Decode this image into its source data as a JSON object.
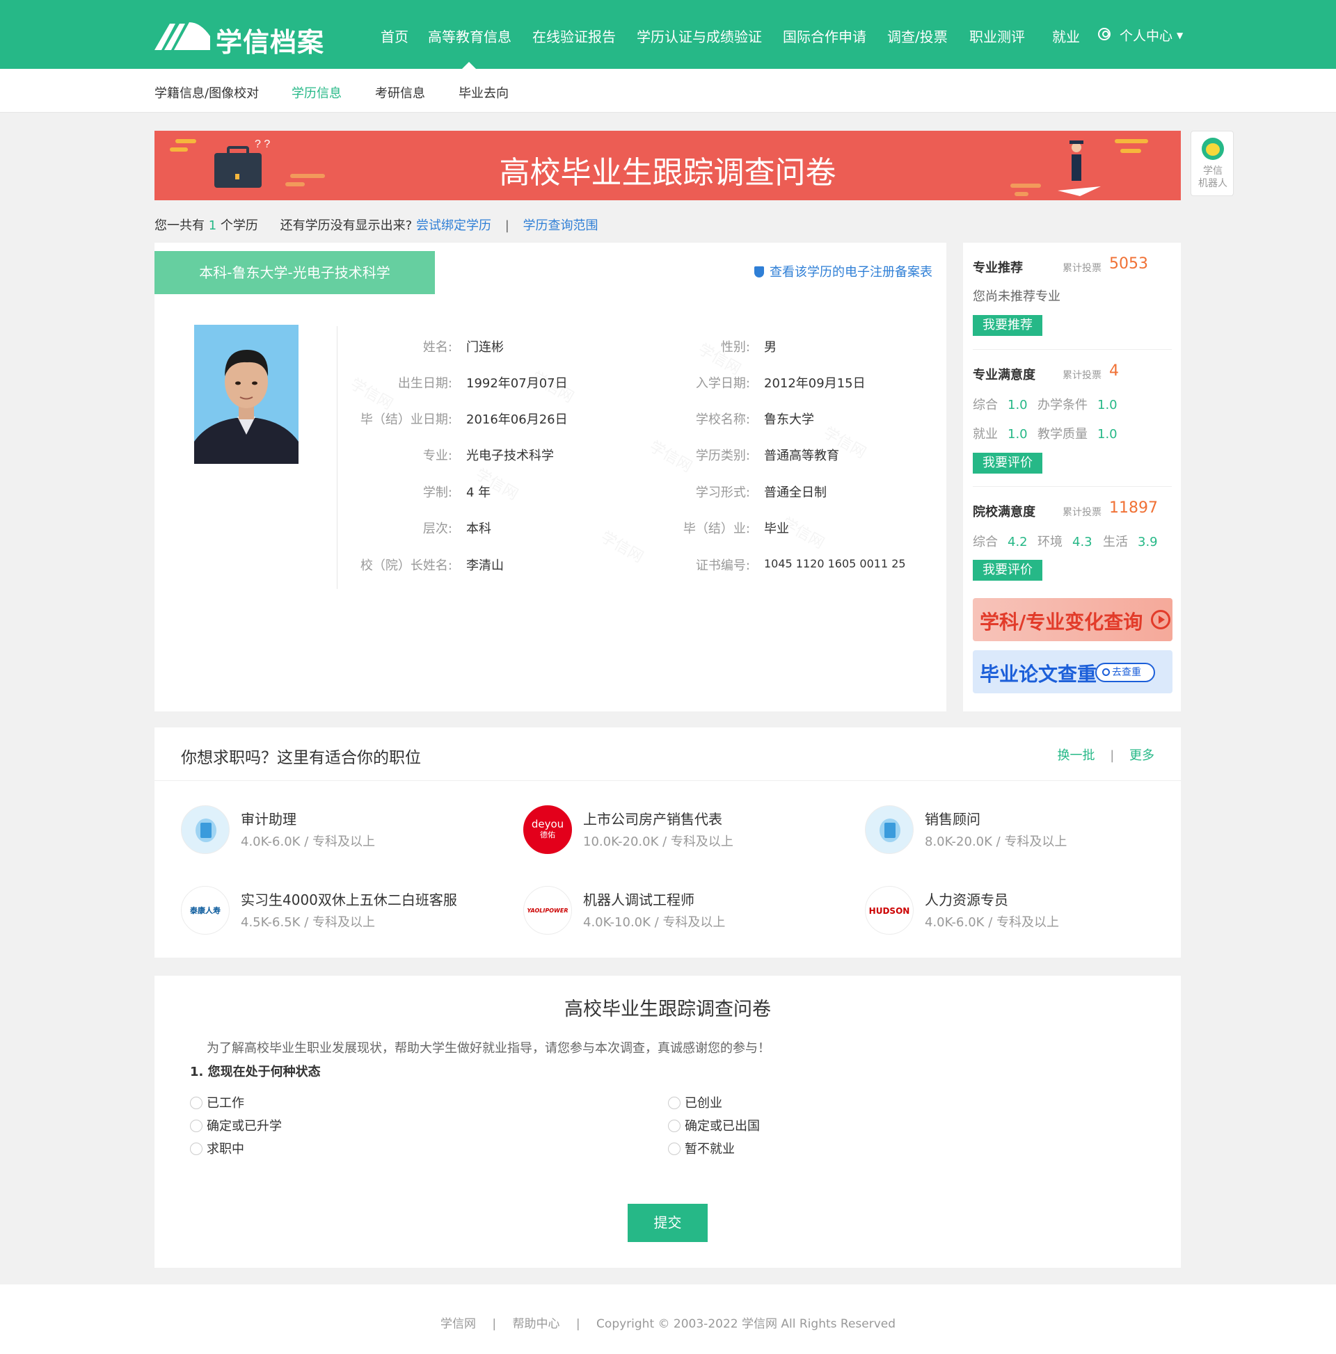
{
  "header": {
    "logo_text": "学信档案",
    "nav": [
      "首页",
      "高等教育信息",
      "在线验证报告",
      "学历认证与成绩验证",
      "国际合作申请",
      "调查/投票",
      "职业测评",
      "就业",
      "个人中心"
    ],
    "active_nav": "高等教育信息",
    "brand_color": "#26b887"
  },
  "subnav": {
    "items": [
      "学籍信息/图像校对",
      "学历信息",
      "考研信息",
      "毕业去向"
    ],
    "active": "学历信息"
  },
  "banner": {
    "title": "高校毕业生跟踪调查问卷"
  },
  "robot": {
    "label_line1": "学信",
    "label_line2": "机器人"
  },
  "summary": {
    "prefix": "您一共有",
    "count": "1",
    "suffix": "个学历",
    "question": "还有学历没有显示出来?",
    "bind_link": "尝试绑定学历",
    "scope_link": "学历查询范围",
    "separator": "|"
  },
  "record": {
    "tab_label": "本科-鲁东大学-光电子技术科学",
    "verify_link": "查看该学历的电子注册备案表",
    "fields_left": [
      {
        "label": "姓名:",
        "value": "门连彬"
      },
      {
        "label": "出生日期:",
        "value": "1992年07月07日"
      },
      {
        "label": "毕（结）业日期:",
        "value": "2016年06月26日"
      },
      {
        "label": "专业:",
        "value": "光电子技术科学"
      },
      {
        "label": "学制:",
        "value": "4 年"
      },
      {
        "label": "层次:",
        "value": "本科"
      },
      {
        "label": "校（院）长姓名:",
        "value": "李清山"
      }
    ],
    "fields_right": [
      {
        "label": "性别:",
        "value": "男"
      },
      {
        "label": "入学日期:",
        "value": "2012年09月15日"
      },
      {
        "label": "学校名称:",
        "value": "鲁东大学"
      },
      {
        "label": "学历类别:",
        "value": "普通高等教育"
      },
      {
        "label": "学习形式:",
        "value": "普通全日制"
      },
      {
        "label": "毕（结）业:",
        "value": "毕业"
      },
      {
        "label": "证书编号:",
        "value": "1045 1120 1605 0011 25"
      }
    ],
    "watermark": "学信网"
  },
  "side": {
    "major_recommend": {
      "title": "专业推荐",
      "votes_label": "累计投票",
      "votes": "5053",
      "text": "您尚未推荐专业",
      "button": "我要推荐"
    },
    "major_satisfaction": {
      "title": "专业满意度",
      "votes_label": "累计投票",
      "votes": "4",
      "r1_label": "综合",
      "r1": "1.0",
      "r2_label": "办学条件",
      "r2": "1.0",
      "r3_label": "就业",
      "r3": "1.0",
      "r4_label": "教学质量",
      "r4": "1.0",
      "button": "我要评价"
    },
    "school_satisfaction": {
      "title": "院校满意度",
      "votes_label": "累计投票",
      "votes": "11897",
      "r1_label": "综合",
      "r1": "4.2",
      "r2_label": "环境",
      "r2": "4.3",
      "r3_label": "生活",
      "r3": "3.9",
      "button": "我要评价"
    },
    "ad_discipline": "学科/专业变化查询",
    "ad_thesis": "毕业论文查重",
    "ad_thesis_button": "去查重"
  },
  "jobs": {
    "title": "你想求职吗？这里有适合你的职位",
    "refresh": "换一批",
    "more": "更多",
    "separator": "|",
    "items": [
      {
        "title": "审计助理",
        "salary": "4.0K-6.0K",
        "edu": "专科及以上",
        "logo": "building-icon"
      },
      {
        "title": "上市公司房产销售代表",
        "salary": "10.0K-20.0K",
        "edu": "专科及以上",
        "logo": "deyou-logo",
        "logo_text1": "deyou",
        "logo_text2": "德佑"
      },
      {
        "title": "销售顾问",
        "salary": "8.0K-20.0K",
        "edu": "专科及以上",
        "logo": "building-icon"
      },
      {
        "title": "实习生4000双休上五休二白班客服",
        "salary": "4.5K-6.5K",
        "edu": "专科及以上",
        "logo": "taikang-logo",
        "logo_text1": "泰康人寿"
      },
      {
        "title": "机器人调试工程师",
        "salary": "4.0K-10.0K",
        "edu": "专科及以上",
        "logo": "yaolipower-logo",
        "logo_text1": "YAOLIPOWER"
      },
      {
        "title": "人力资源专员",
        "salary": "4.0K-6.0K",
        "edu": "专科及以上",
        "logo": "hudson-logo",
        "logo_text1": "HUDSON"
      }
    ]
  },
  "survey": {
    "title": "高校毕业生跟踪调查问卷",
    "intro": "为了解高校毕业生职业发展现状，帮助大学生做好就业指导，请您参与本次调查，真诚感谢您的参与！",
    "question": "1. 您现在处于何种状态",
    "options_left": [
      "已工作",
      "确定或已升学",
      "求职中"
    ],
    "options_right": [
      "已创业",
      "确定或已出国",
      "暂不就业"
    ],
    "submit": "提交"
  },
  "footer": {
    "link1": "学信网",
    "link2": "帮助中心",
    "copyright": "Copyright © 2003-2022 学信网 All Rights Reserved",
    "separator": "|"
  }
}
